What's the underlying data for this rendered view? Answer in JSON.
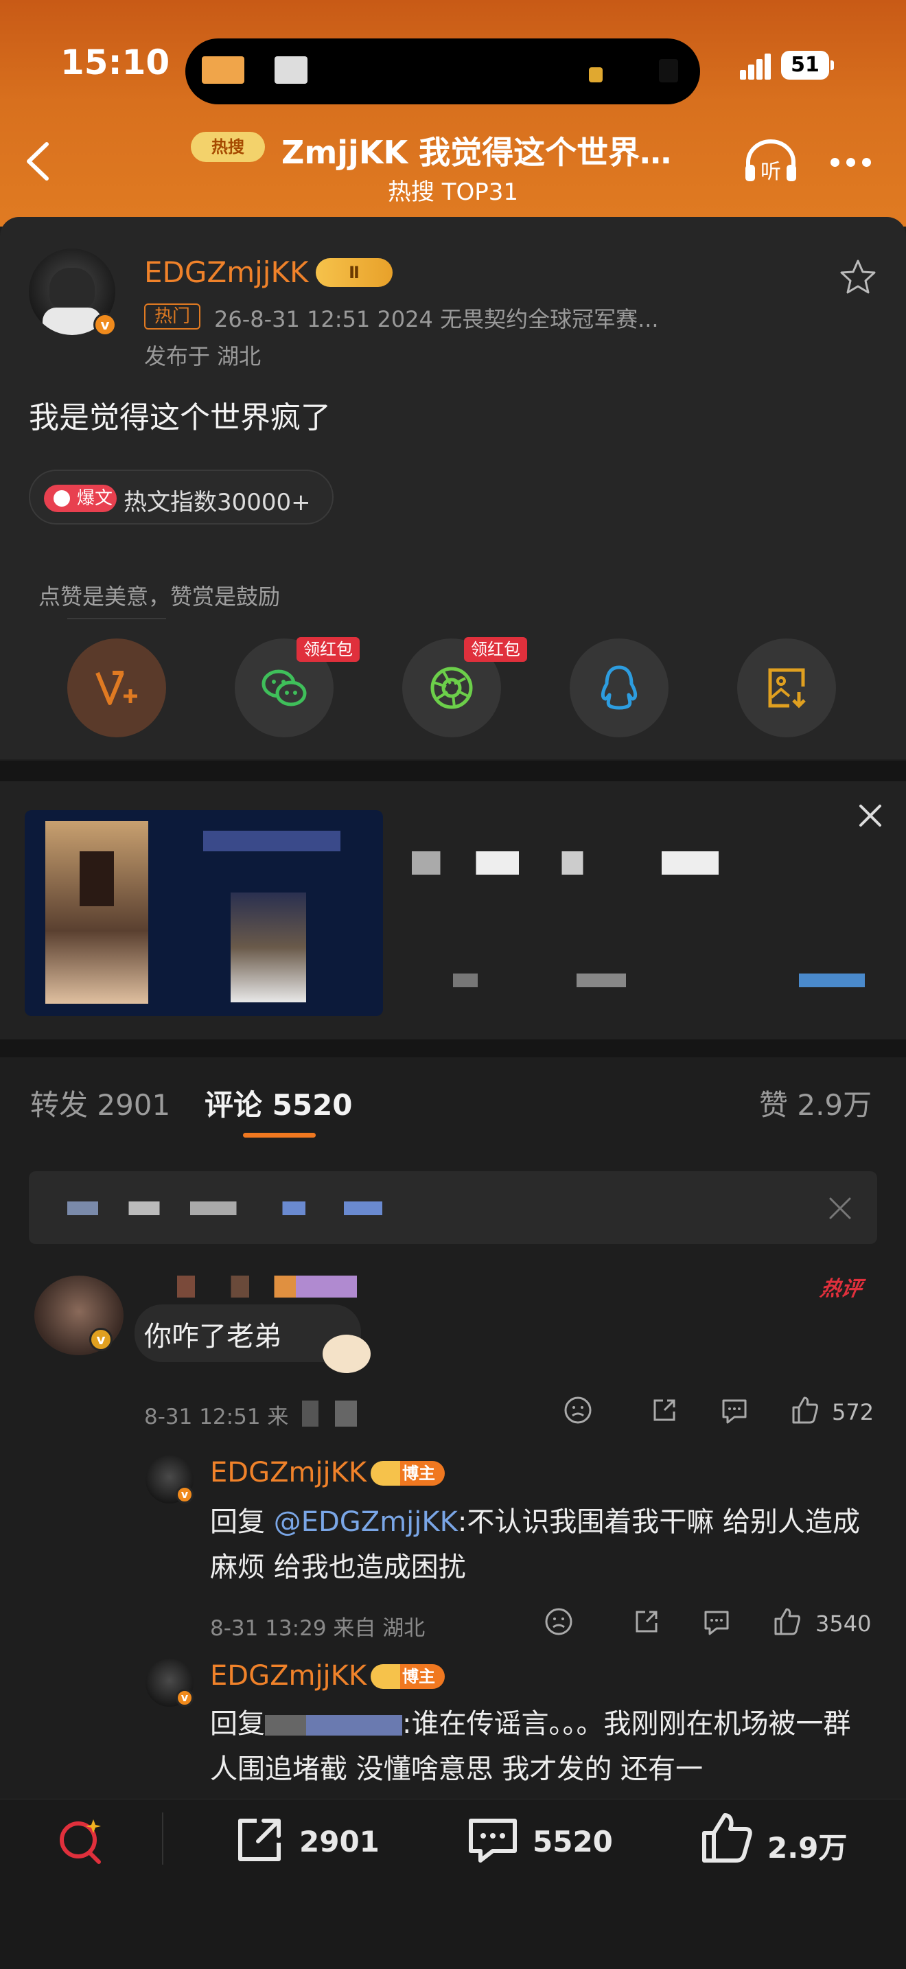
{
  "status": {
    "time": "15:10",
    "battery": "51"
  },
  "header": {
    "badge": "热搜",
    "title": "ZmjjKK 我觉得这个世界…",
    "subtitle": "热搜 TOP31",
    "listen": "听"
  },
  "post": {
    "username": "EDGZmjjKK",
    "level": "Ⅱ",
    "hot_tag": "热门",
    "meta": "26-8-31 12:51  2024 无畏契约全球冠军赛...",
    "location": "发布于 湖北",
    "text": "我是觉得这个世界疯了",
    "hot_pill_label": "爆文",
    "hot_pill_text": "热文指数30000+",
    "hint": "点赞是美意，赞赏是鼓励",
    "redpacket_1": "领红包",
    "redpacket_2": "领红包"
  },
  "tabs": {
    "repost": "转发 2901",
    "comment": "评论 5520",
    "like": "赞 2.9万"
  },
  "comments": {
    "hot_label": "热评",
    "c1": {
      "text": "你咋了老弟",
      "meta": "8-31 12:51  来",
      "likes": "572"
    },
    "r1": {
      "name": "EDGZmjjKK",
      "badge": "博主",
      "prefix": "回复 ",
      "mention": "@EDGZmjjKK",
      "body": ":不认识我围着我干嘛 给别人造成麻烦 给我也造成困扰",
      "meta": "8-31 13:29  来自 湖北",
      "likes": "3540"
    },
    "r2": {
      "name": "EDGZmjjKK",
      "badge": "博主",
      "prefix": "回复",
      "body": ":谁在传谣言。。。我刚刚在机场被一群人围追堵截 没懂啥意思 我才发的 还有一"
    }
  },
  "bottom": {
    "repost": "2901",
    "comment": "5520",
    "like": "2.9万"
  },
  "colors": {
    "accent": "#f0822a",
    "hot": "#e0303c",
    "mention": "#7aa6e6"
  }
}
